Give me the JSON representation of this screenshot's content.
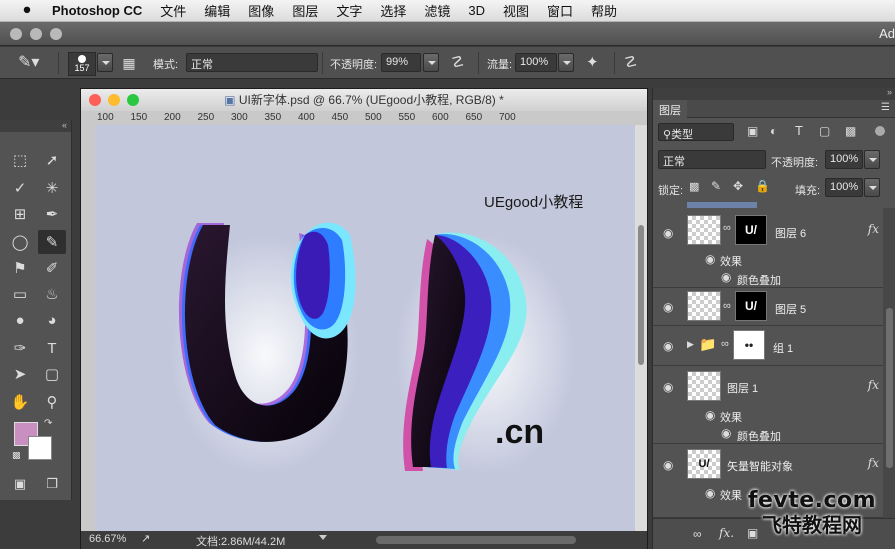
{
  "menubar": {
    "apple": "",
    "items": [
      "Photoshop CC",
      "文件",
      "编辑",
      "图像",
      "图层",
      "文字",
      "选择",
      "滤镜",
      "3D",
      "视图",
      "窗口",
      "帮助"
    ]
  },
  "appbar": {
    "right_text": "Ad"
  },
  "options": {
    "brush_size": "157",
    "mode_label": "模式:",
    "mode_value": "正常",
    "opacity_label": "不透明度:",
    "opacity_value": "99%",
    "flow_label": "流量:",
    "flow_value": "100%"
  },
  "document": {
    "title": "UI新字体.psd @ 66.7% (UEgood小教程, RGB/8) *",
    "ruler_ticks": [
      "100",
      "150",
      "200",
      "250",
      "300",
      "350",
      "400",
      "450",
      "500",
      "550",
      "600",
      "650",
      "700"
    ],
    "canvas_text": "UEgood小教程",
    "canvas_cn": ".cn",
    "zoom": "66.67%",
    "doc_info": "文档:2.86M/44.2M"
  },
  "layers_panel": {
    "tab": "图层",
    "filter_label": "类型",
    "blend_mode": "正常",
    "opacity_label": "不透明度:",
    "opacity_value": "100%",
    "lock_label": "锁定:",
    "fill_label": "填充:",
    "fill_value": "100%",
    "layers": [
      {
        "name": "图层 6",
        "fx": "fx",
        "effects_label": "效果",
        "effect": "颜色叠加"
      },
      {
        "name": "图层 5"
      },
      {
        "name": "组 1"
      },
      {
        "name": "图层 1",
        "fx": "fx",
        "effects_label": "效果",
        "effect": "颜色叠加"
      },
      {
        "name": "矢量智能对象",
        "fx": "fx",
        "effects_label": "效果"
      }
    ]
  },
  "watermark": {
    "line1": "fevte.com",
    "line2": "飞特教程网"
  },
  "colors": {
    "foreground": "#c98fc0",
    "background": "#ffffff",
    "canvas": "#c2c7dc"
  }
}
